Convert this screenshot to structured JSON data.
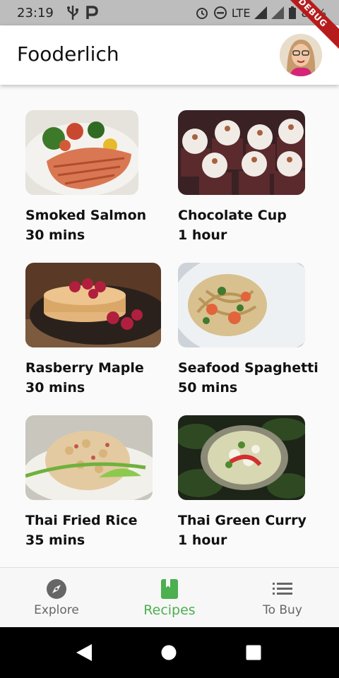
{
  "status_bar": {
    "time": "23:19",
    "network": "LTE",
    "battery": "85%"
  },
  "app_bar": {
    "title": "Fooderlich",
    "debug_label": "DEBUG"
  },
  "recipes": [
    {
      "name": "Smoked Salmon",
      "time": "30 mins"
    },
    {
      "name": "Chocolate Cup",
      "time": "1 hour"
    },
    {
      "name": "Rasberry Maple",
      "time": "30 mins"
    },
    {
      "name": "Seafood Spaghetti",
      "time": "50 mins"
    },
    {
      "name": "Thai Fried Rice",
      "time": "35 mins"
    },
    {
      "name": "Thai Green Curry",
      "time": "1 hour"
    }
  ],
  "bottom_nav": {
    "items": [
      {
        "label": "Explore",
        "icon": "explore-icon"
      },
      {
        "label": "Recipes",
        "icon": "book-icon"
      },
      {
        "label": "To Buy",
        "icon": "list-icon"
      }
    ],
    "active_color": "#4caf50"
  }
}
